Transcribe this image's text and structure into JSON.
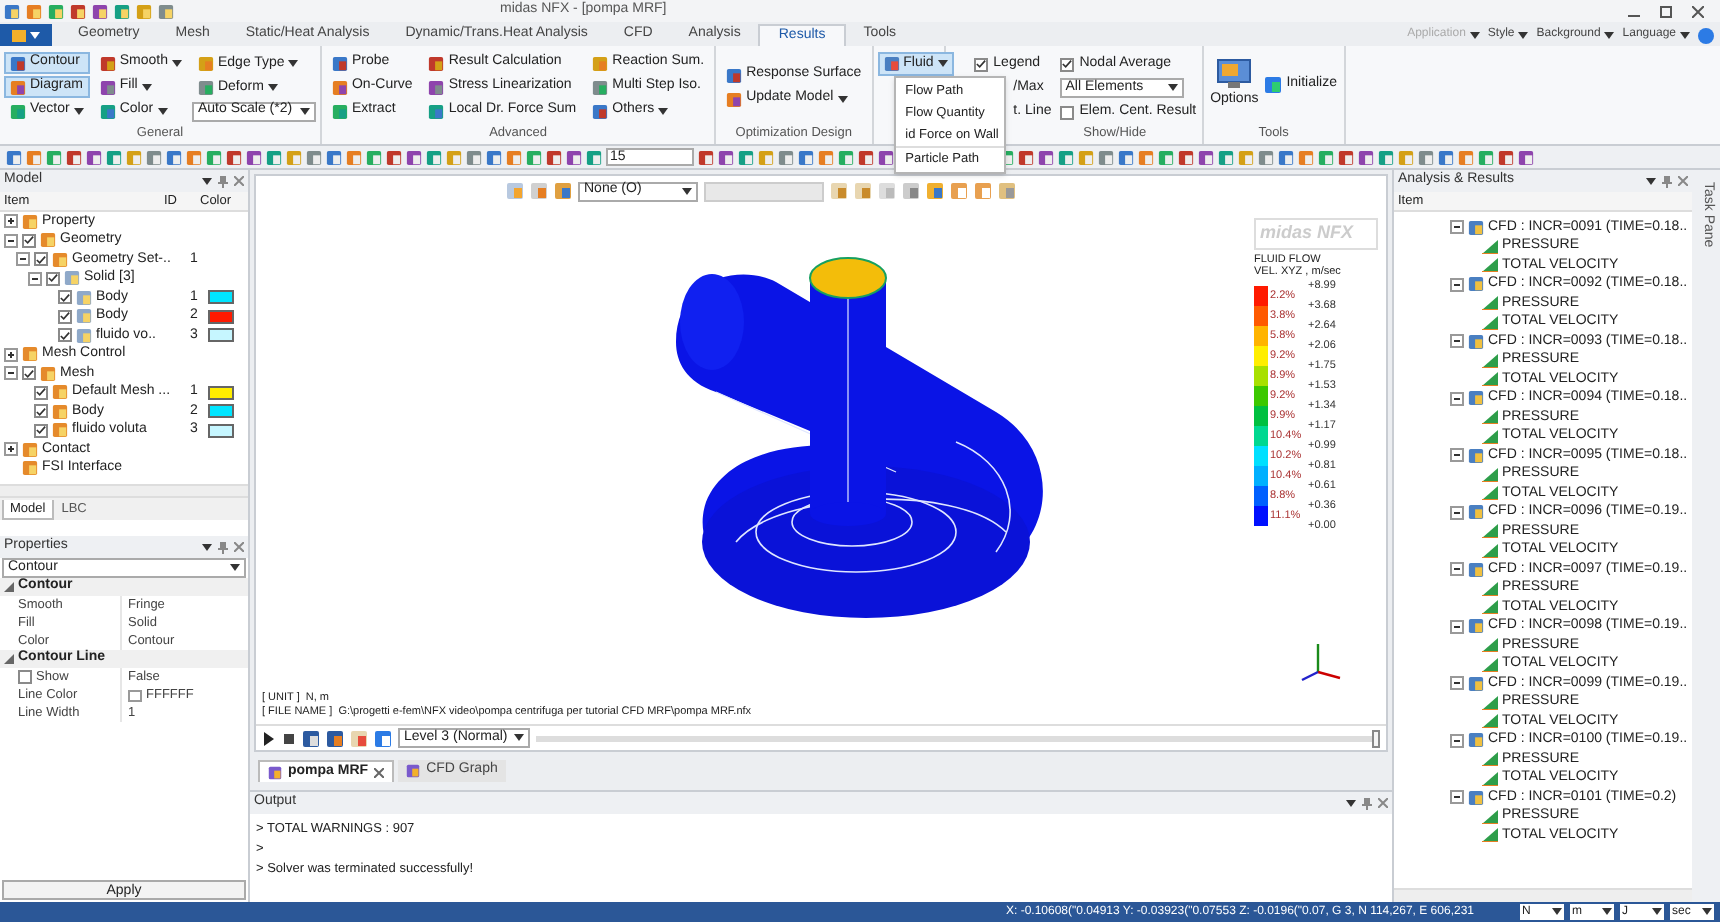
{
  "window": {
    "title": "midas NFX - [pompa MRF]"
  },
  "tabs": [
    {
      "label": "Geometry",
      "selected": false
    },
    {
      "label": "Mesh",
      "selected": false
    },
    {
      "label": "Static/Heat Analysis",
      "selected": false
    },
    {
      "label": "Dynamic/Trans.Heat Analysis",
      "selected": false
    },
    {
      "label": "CFD",
      "selected": false
    },
    {
      "label": "Analysis",
      "selected": false
    },
    {
      "label": "Results",
      "selected": true
    },
    {
      "label": "Tools",
      "selected": false
    }
  ],
  "top_menus": [
    "Application",
    "Style",
    "Background",
    "Language"
  ],
  "ribbon": [
    {
      "kind": "buttons",
      "title": "General",
      "items": [
        {
          "label": "Contour",
          "selected": true,
          "dropdown": false
        },
        {
          "label": "Diagram",
          "selected": true,
          "dropdown": false
        },
        {
          "label": "Vector",
          "selected": false,
          "dropdown": true
        },
        {
          "label": "Smooth",
          "selected": false,
          "dropdown": true
        },
        {
          "label": "Fill",
          "selected": false,
          "dropdown": true
        },
        {
          "label": "Color",
          "selected": false,
          "dropdown": true
        },
        {
          "label": "Edge Type",
          "selected": false,
          "dropdown": true
        },
        {
          "label": "Deform",
          "selected": false,
          "dropdown": true
        }
      ],
      "select": "Auto Scale (*2)"
    },
    {
      "kind": "buttons",
      "title": "Advanced",
      "items": [
        {
          "label": "Probe",
          "selected": false,
          "dropdown": false
        },
        {
          "label": "On-Curve",
          "selected": false,
          "dropdown": false
        },
        {
          "label": "Extract",
          "selected": false,
          "dropdown": false
        },
        {
          "label": "Result Calculation",
          "selected": false,
          "dropdown": false
        },
        {
          "label": "Stress Linearization",
          "selected": false,
          "dropdown": false
        },
        {
          "label": "Local Dr. Force Sum",
          "selected": false,
          "dropdown": false
        },
        {
          "label": "Reaction Sum.",
          "selected": false,
          "dropdown": false
        },
        {
          "label": "Multi Step Iso.",
          "selected": false,
          "dropdown": false
        },
        {
          "label": "Others",
          "selected": false,
          "dropdown": true
        }
      ]
    },
    {
      "kind": "buttons",
      "title": "Optimization Design",
      "items": [
        {
          "label": "Response Surface",
          "selected": false,
          "dropdown": false
        },
        {
          "label": "Update Model",
          "selected": false,
          "dropdown": true
        }
      ]
    },
    {
      "kind": "fluid",
      "button": {
        "label": "Fluid",
        "selected": true,
        "dropdown": true
      },
      "menu": [
        "Flow Path",
        "Flow Quantity",
        "id Force on Wall",
        "Particle Path"
      ]
    },
    {
      "kind": "showhide",
      "title": "Show/Hide",
      "items": [
        {
          "kind": "check",
          "label": "Legend",
          "checked": true
        },
        {
          "kind": "text",
          "label": "/Max"
        },
        {
          "kind": "text",
          "label": "t. Line"
        },
        {
          "kind": "check",
          "label": "Nodal Average",
          "checked": true
        },
        {
          "kind": "select",
          "label": "All Elements"
        },
        {
          "kind": "check",
          "label": "Elem. Cent. Result",
          "checked": false
        }
      ]
    },
    {
      "kind": "tools",
      "title": "Tools",
      "items": [
        "Options",
        "Initialize"
      ]
    }
  ],
  "toolbar": {
    "scale_value": "15"
  },
  "model_panel": {
    "title": "Model",
    "columns": [
      "Item",
      "ID",
      "Color"
    ],
    "tree": [
      {
        "label": "Property",
        "expanded": false
      },
      {
        "label": "Geometry",
        "expanded": true,
        "checked": true,
        "children": [
          {
            "label": "Geometry Set-..",
            "id": "1",
            "expanded": true,
            "checked": true,
            "children": [
              {
                "label": "Solid [3]",
                "expanded": true,
                "checked": true,
                "children": [
                  {
                    "label": "Body",
                    "id": "1",
                    "checked": true,
                    "color": "#00e5ff"
                  },
                  {
                    "label": "Body",
                    "id": "2",
                    "checked": true,
                    "color": "#ff1a00"
                  },
                  {
                    "label": "fluido vo..",
                    "id": "3",
                    "checked": true,
                    "color": "#c6f6ff"
                  }
                ]
              }
            ]
          }
        ]
      },
      {
        "label": "Mesh Control",
        "expanded": false
      },
      {
        "label": "Mesh",
        "expanded": true,
        "checked": true,
        "children": [
          {
            "label": "Default Mesh ...",
            "id": "1",
            "checked": true,
            "color": "#ffee00"
          },
          {
            "label": "Body",
            "id": "2",
            "checked": true,
            "color": "#00e5ff"
          },
          {
            "label": "fluido voluta",
            "id": "3",
            "checked": true,
            "color": "#c6f6ff"
          }
        ]
      },
      {
        "label": "Contact",
        "expanded": false
      },
      {
        "label": "FSI Interface"
      }
    ],
    "tabs": [
      {
        "label": "Model",
        "selected": true
      },
      {
        "label": "LBC",
        "selected": false
      }
    ]
  },
  "properties": {
    "title": "Properties",
    "selector": "Contour",
    "sections": [
      {
        "title": "Contour",
        "expanded": true,
        "rows": [
          {
            "kind": "text",
            "name": "Smooth",
            "value": "Fringe"
          },
          {
            "kind": "text",
            "name": "Fill",
            "value": "Solid"
          },
          {
            "kind": "text",
            "name": "Color",
            "value": "Contour"
          }
        ]
      },
      {
        "title": "Contour Line",
        "expanded": true,
        "rows": [
          {
            "kind": "check",
            "name": "Show",
            "value": "False",
            "checked": false
          },
          {
            "kind": "color",
            "name": "Line Color",
            "value": "FFFFFF",
            "color": "#ffffff"
          },
          {
            "kind": "text",
            "name": "Line Width",
            "value": "1"
          }
        ]
      }
    ],
    "apply": "Apply"
  },
  "viewport": {
    "view_select": "None (O)",
    "legend": {
      "logo": "midas NFX",
      "title": "FLUID FLOW",
      "subtitle": "VEL. XYZ , m/sec",
      "bands": [
        {
          "color": "#ff1a00",
          "percent": "2.2%"
        },
        {
          "color": "#ff5a00",
          "percent": "3.8%"
        },
        {
          "color": "#ffb400",
          "percent": "5.8%"
        },
        {
          "color": "#ffee00",
          "percent": "9.2%"
        },
        {
          "color": "#a8e000",
          "percent": "8.9%"
        },
        {
          "color": "#3cc800",
          "percent": "9.2%"
        },
        {
          "color": "#00c040",
          "percent": "9.9%"
        },
        {
          "color": "#00d890",
          "percent": "10.4%"
        },
        {
          "color": "#00e0ff",
          "percent": "10.2%"
        },
        {
          "color": "#00b0ff",
          "percent": "10.4%"
        },
        {
          "color": "#0060ff",
          "percent": "8.8%"
        },
        {
          "color": "#0010ff",
          "percent": "11.1%"
        }
      ],
      "ticks": [
        "+8.99",
        "+3.68",
        "+2.64",
        "+2.06",
        "+1.75",
        "+1.53",
        "+1.34",
        "+1.17",
        "+0.99",
        "+0.81",
        "+0.61",
        "+0.36",
        "+0.00"
      ]
    },
    "info": [
      "[ UNIT ]  N, m",
      "[ FILE NAME ]  G:\\progetti e-fem\\NFX video\\pompa centrifuga per tutorial CFD MRF\\pompa MRF.nfx"
    ],
    "playback": {
      "level_select": "Level 3 (Normal)",
      "timeline": {
        "level": 1
      }
    },
    "doc_tabs": [
      {
        "label": "pompa MRF",
        "selected": true
      },
      {
        "label": "CFD Graph",
        "selected": false
      }
    ]
  },
  "output": {
    "title": "Output",
    "lines": [
      "> TOTAL WARNINGS : 907",
      ">",
      "> Solver was terminated successfully!"
    ]
  },
  "results_panel": {
    "title": "Analysis & Results",
    "column": "Item",
    "tree": [
      {
        "label": "CFD : INCR=0091 (TIME=0.18..",
        "expanded": true,
        "children": [
          {
            "label": "PRESSURE"
          },
          {
            "label": "TOTAL VELOCITY"
          }
        ]
      },
      {
        "label": "CFD : INCR=0092 (TIME=0.18..",
        "expanded": true,
        "children": [
          {
            "label": "PRESSURE"
          },
          {
            "label": "TOTAL VELOCITY"
          }
        ]
      },
      {
        "label": "CFD : INCR=0093 (TIME=0.18..",
        "expanded": true,
        "children": [
          {
            "label": "PRESSURE"
          },
          {
            "label": "TOTAL VELOCITY"
          }
        ]
      },
      {
        "label": "CFD : INCR=0094 (TIME=0.18..",
        "expanded": true,
        "children": [
          {
            "label": "PRESSURE"
          },
          {
            "label": "TOTAL VELOCITY"
          }
        ]
      },
      {
        "label": "CFD : INCR=0095 (TIME=0.18..",
        "expanded": true,
        "children": [
          {
            "label": "PRESSURE"
          },
          {
            "label": "TOTAL VELOCITY"
          }
        ]
      },
      {
        "label": "CFD : INCR=0096 (TIME=0.19..",
        "expanded": true,
        "children": [
          {
            "label": "PRESSURE"
          },
          {
            "label": "TOTAL VELOCITY"
          }
        ]
      },
      {
        "label": "CFD : INCR=0097 (TIME=0.19..",
        "expanded": true,
        "children": [
          {
            "label": "PRESSURE"
          },
          {
            "label": "TOTAL VELOCITY"
          }
        ]
      },
      {
        "label": "CFD : INCR=0098 (TIME=0.19..",
        "expanded": true,
        "children": [
          {
            "label": "PRESSURE"
          },
          {
            "label": "TOTAL VELOCITY"
          }
        ]
      },
      {
        "label": "CFD : INCR=0099 (TIME=0.19..",
        "expanded": true,
        "children": [
          {
            "label": "PRESSURE"
          },
          {
            "label": "TOTAL VELOCITY"
          }
        ]
      },
      {
        "label": "CFD : INCR=0100 (TIME=0.19..",
        "expanded": true,
        "children": [
          {
            "label": "PRESSURE"
          },
          {
            "label": "TOTAL VELOCITY"
          }
        ]
      },
      {
        "label": "CFD : INCR=0101 (TIME=0.2)",
        "expanded": true,
        "children": [
          {
            "label": "PRESSURE"
          },
          {
            "label": "TOTAL VELOCITY"
          }
        ]
      }
    ]
  },
  "task_pane": "Task Pane",
  "status_bar": {
    "coords": "X: -0.10608(\"0.04913 Y: -0.03923(\"0.07553 Z: -0.0196(\"0.07, G 3, N 114,267, E 606,231",
    "units": [
      "N",
      "m",
      "J",
      "sec"
    ]
  }
}
